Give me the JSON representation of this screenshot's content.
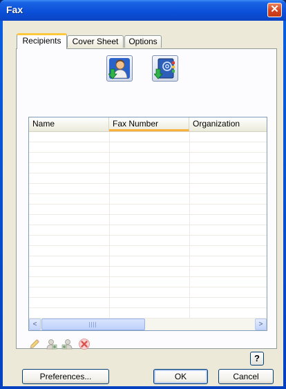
{
  "window": {
    "title": "Fax",
    "close_glyph": "✕"
  },
  "tabs": [
    {
      "label": "Recipients",
      "active": true
    },
    {
      "label": "Cover Sheet",
      "active": false
    },
    {
      "label": "Options",
      "active": false
    }
  ],
  "toolbar": {
    "add_from_contacts_icon": "person-with-green-arrow-icon",
    "add_from_address_book_icon": "address-book-with-green-arrow-icon"
  },
  "recipients_table": {
    "columns": [
      "Name",
      "Fax Number",
      "Organization"
    ],
    "sorted_column": "Fax Number",
    "rows": []
  },
  "scrollbar": {
    "left_arrow": "<",
    "right_arrow": ">"
  },
  "row_actions": {
    "edit_icon": "pencil-icon",
    "add_recipient_icon": "add-recipient-icon",
    "remove_recipient_icon": "remove-recipient-icon",
    "delete_icon": "red-x-icon"
  },
  "help": {
    "label": "?"
  },
  "buttons": {
    "preferences": "Preferences...",
    "ok": "OK",
    "cancel": "Cancel"
  },
  "colors": {
    "titlebar": "#0a4fd8",
    "close": "#d5411e",
    "tab_highlight": "#ffc83c",
    "dialog_bg": "#ece9d8"
  }
}
